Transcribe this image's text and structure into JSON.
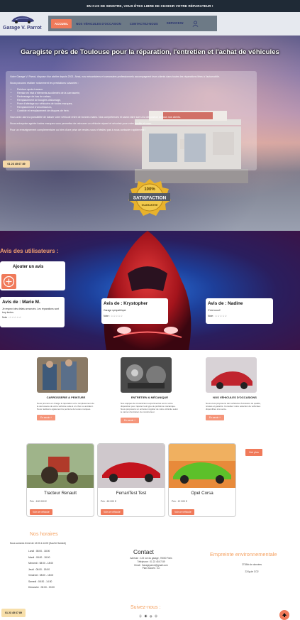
{
  "topbar": {
    "text": "EN CAS DE SINISTRE, VOUS ÊTES LIBRE DE CHOISIR VOTRE RÉPARATEUR !"
  },
  "brand": {
    "name": "Garage V. Parrot"
  },
  "nav": {
    "items": [
      "ACCUEIL",
      "NOS VÉHICULES D'OCCASION",
      "CONTACTEZ-NOUS",
      "SERVICES"
    ],
    "services_caret": "▾",
    "user_icon": "user-icon"
  },
  "hero": {
    "title": "Garagiste près de Toulouse pour la réparation, l'entretien et l'achat de véhicules",
    "intro": "Votre Garage V. Parrot, dispose d'un atelier depuis 2021. Ainsi, nos mécaniciens et carrossiers professionnels accompagnent leurs clients dans toutes les réparations liées à l'automobile.",
    "services_intro": "Nous pouvons réaliser notamment les prestations suivantes :",
    "services": [
      "Peinture après travaux",
      "Remise en état d'éléments accidentés de la carrosserie,",
      "Redressage de bas de caisse,",
      "Remplacement de bougies d'allumage,",
      "Pose d'attelage sur véhicules de toutes marques,",
      "Remplacement d'amortisseurs,",
      "Contrôle et remplacement de disques de frein."
    ],
    "para2": "Vous avez alors la possibilité de laisser votre véhicule entre de bonnes mains. Nos compétences et savoir-faire sont à la disposition de tous nos clients.",
    "para3": "Nous entreprise agréée toutes marques vous permettra de retrouver un véhicule réparé et sécurisé pour votre famille et vous.",
    "para4": "Pour un renseignement complémentaire ou bien d'une prise de rendez-vous n'hésitez pas à nous contacter rapidement !",
    "phone": "01 23 45 67 89",
    "badge_top": "100%",
    "badge_main": "SATISFACTION",
    "badge_sub": "GUARANTEE"
  },
  "reviews": {
    "title": "Avis des utilisateurs :",
    "add_label": "Ajouter un avis",
    "items": [
      {
        "title": "Avis de : Marie M.",
        "text": "Je respect des délais annoncés. Les réparations sont trop lentes.",
        "rating_label": "Note :",
        "stars": "☆☆☆☆☆"
      },
      {
        "title": "Avis de : Krystopher",
        "text": "Garage sympathique",
        "rating_label": "Note :",
        "stars": "☆☆☆☆☆"
      },
      {
        "title": "Avis de : Nadine",
        "text": "C'est cuuul!",
        "rating_label": "Note :",
        "stars": "☆☆☆☆☆"
      }
    ]
  },
  "services": [
    {
      "title": "CARROSSERIE & PEINTURE",
      "desc": "Nous prenons en charge la réparation et le remplacement de la carrosserie de votre véhicule suite à un choc ou accident. Nous réalisons également la peinture de toutes marques.",
      "button": "En savoir +"
    },
    {
      "title": "ENTRETIEN & MÉCANIQUE",
      "desc": "Nos équipes de mécaniciens expérimentés sont à votre disposition pour réparer tout type de problème mécanique. Nous proposons un entretien régulier de votre véhicule selon le carnet d'entretien du constructeur.",
      "button": "En savoir +"
    },
    {
      "title": "NOS VÉHICULES D'OCCASIONS",
      "desc": "Nous vous proposons des véhicules d'occasion de qualité, révisés et garantis. Consultez notre sélection de véhicules disponibles à la vente.",
      "button": "En savoir +"
    }
  ],
  "vehicles": {
    "more": "Voir plus",
    "items": [
      {
        "name": "Tracteur Renault",
        "price": "Prix : 100 000 €",
        "button": "Voir ce véhicule"
      },
      {
        "name": "FerrariTest Test",
        "price": "Prix : 60 000 €",
        "button": "Voir ce véhicule"
      },
      {
        "name": "Opel Corsa",
        "price": "Prix : 12 000 €",
        "button": "Voir ce véhicule"
      }
    ]
  },
  "footer": {
    "hours_title": "Nos horaires",
    "hours_sub": "Nous sommes fermé de 12:00 à 14:00 (Sauf le Samedi)",
    "hours": [
      "Lundi : 08:00 - 18:00",
      "Mardi : 08:00 - 18:00",
      "Mercredi : 08:00 - 18:00",
      "Jeudi : 08:00 - 18:00",
      "Vendredi : 08:00 - 18:00",
      "Samedi : 08:30 - 14:30",
      "Dimanche : 00:00 - 00:00"
    ],
    "contact_title": "Contact",
    "contact": [
      "Adresse : 123 rue du garage, 75000 Paris",
      "Téléphone : 01 23 45 67 89",
      "Email : Garageparrot@gmail.com",
      "Plan d'accès : ICI"
    ],
    "eco_title": "Empreinte environnementale",
    "eco": [
      "2718kb de données",
      "224g de CO2"
    ],
    "follow": "Suivez-nous :",
    "social": "⓪ ◉ ◍ ⊕",
    "phone": "01 23 45 67 89"
  }
}
